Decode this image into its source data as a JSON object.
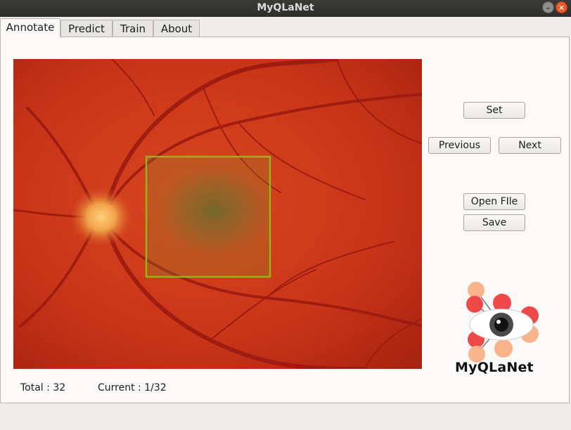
{
  "window": {
    "title": "MyQLaNet"
  },
  "tabs": [
    {
      "label": "Annotate",
      "active": true
    },
    {
      "label": "Predict",
      "active": false
    },
    {
      "label": "Train",
      "active": false
    },
    {
      "label": "About",
      "active": false
    }
  ],
  "buttons": {
    "set": "Set",
    "previous": "Previous",
    "next": "Next",
    "open_file": "Open FIle",
    "save": "Save"
  },
  "status": {
    "total": "Total : 32",
    "current": "Current : 1/32"
  },
  "logo": {
    "text": "MyQLaNet"
  },
  "colors": {
    "fundus_background": "#c8311c",
    "annotation_box": "#8fb516",
    "close_button": "#e9592a"
  }
}
